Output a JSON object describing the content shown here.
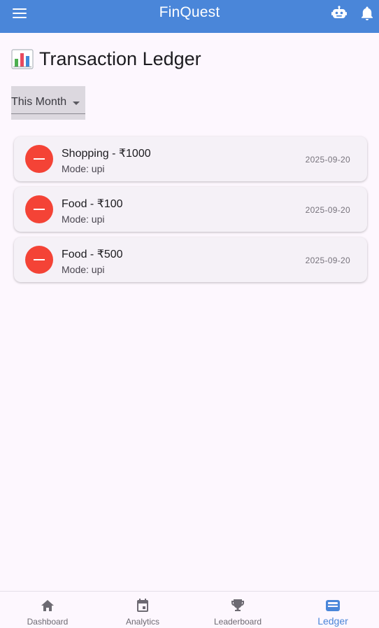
{
  "appbar": {
    "title": "FinQuest",
    "menu_icon": "menu-icon",
    "bot_icon": "robot-icon",
    "bell_icon": "bell-icon",
    "color": "#4a86d9"
  },
  "page": {
    "emoji_icon": "bar-chart-emoji",
    "title": "Transaction Ledger"
  },
  "filter": {
    "selected": "This Month"
  },
  "transactions": [
    {
      "title": "Shopping - ₹1000",
      "mode": "Mode: upi",
      "date": "2025-09-20",
      "type": "expense",
      "icon": "minus-circle-icon"
    },
    {
      "title": "Food - ₹100",
      "mode": "Mode: upi",
      "date": "2025-09-20",
      "type": "expense",
      "icon": "minus-circle-icon"
    },
    {
      "title": "Food - ₹500",
      "mode": "Mode: upi",
      "date": "2025-09-20",
      "type": "expense",
      "icon": "minus-circle-icon"
    }
  ],
  "nav": {
    "items": [
      {
        "label": "Dashboard",
        "icon": "home-icon"
      },
      {
        "label": "Analytics",
        "icon": "calendar-icon"
      },
      {
        "label": "Leaderboard",
        "icon": "trophy-icon"
      },
      {
        "label": "Ledger",
        "icon": "wallet-icon",
        "active": true
      }
    ],
    "active_color": "#4a86d9"
  },
  "colors": {
    "expense": "#f44336",
    "background": "#fdf7fe"
  }
}
